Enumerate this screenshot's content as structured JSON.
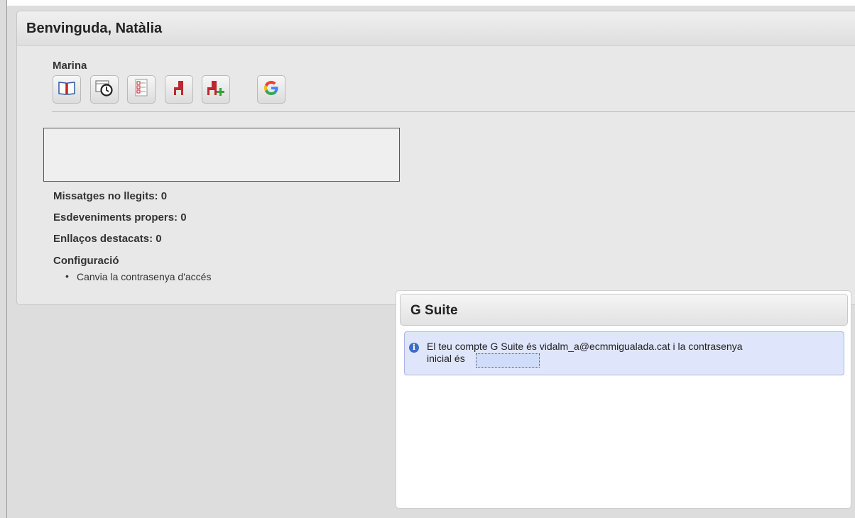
{
  "welcome": {
    "title": "Benvinguda, Natàlia",
    "user": "Marina"
  },
  "toolbar": {
    "items": [
      {
        "icon": "notebook-icon"
      },
      {
        "icon": "calendar-clock-icon"
      },
      {
        "icon": "checklist-icon"
      },
      {
        "icon": "red-chair-icon"
      },
      {
        "icon": "red-chair-add-icon"
      },
      {
        "icon": "google-icon"
      }
    ]
  },
  "stats": {
    "unread_messages": "Missatges no llegits: 0",
    "upcoming_events": "Esdeveniments propers: 0",
    "featured_links": "Enllaços destacats: 0"
  },
  "config": {
    "heading": "Configuració",
    "change_password": "Canvia la contrasenya d'accés"
  },
  "gsuite": {
    "title": "G Suite",
    "message_line1": "El teu compte G Suite és vidalm_a@ecmmigualada.cat i la contrasenya",
    "message_line2": "inicial és"
  },
  "colors": {
    "info_bg": "#dfe5fb",
    "info_border": "#a9b6ea",
    "chair_red": "#c0262d",
    "plus_green": "#2fa33a"
  }
}
